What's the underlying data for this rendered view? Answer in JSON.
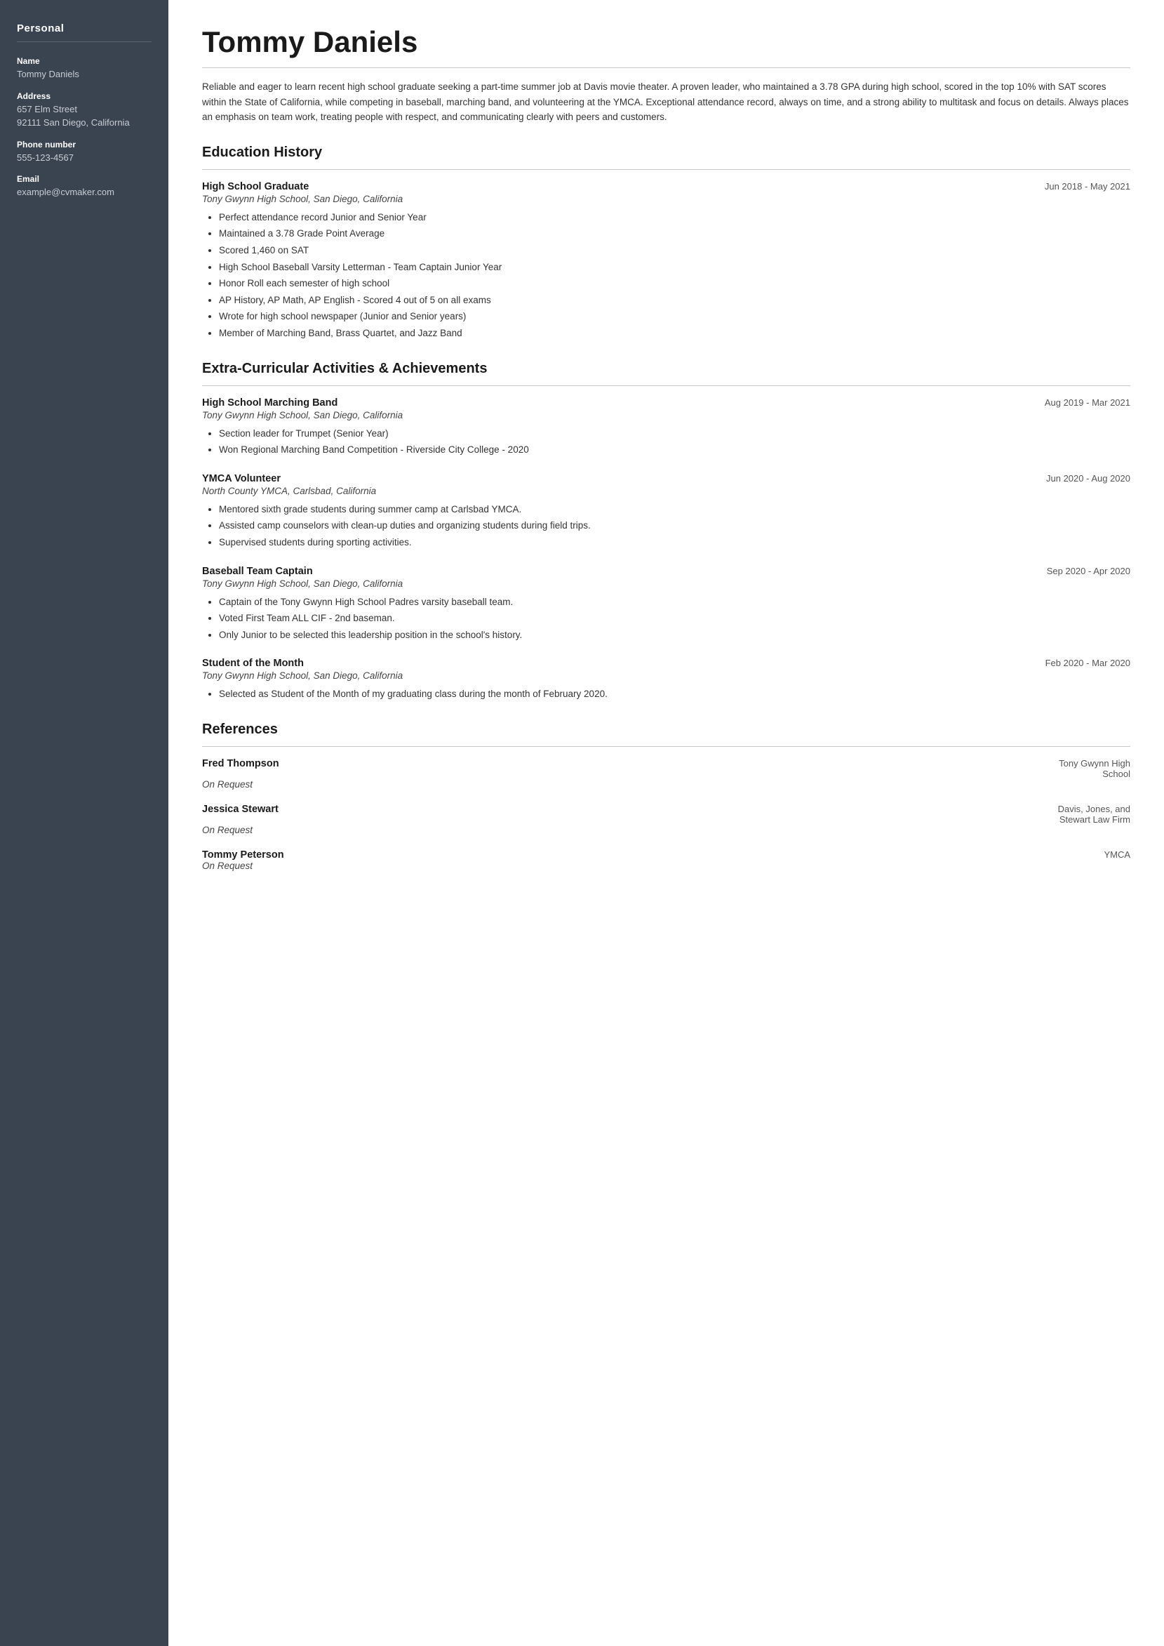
{
  "sidebar": {
    "section": "Personal",
    "fields": [
      {
        "label": "Name",
        "value": "Tommy Daniels"
      },
      {
        "label": "Address",
        "value": "657 Elm Street\n92111 San Diego, California"
      },
      {
        "label": "Phone number",
        "value": "555-123-4567"
      },
      {
        "label": "Email",
        "value": "example@cvmaker.com"
      }
    ]
  },
  "main": {
    "name": "Tommy Daniels",
    "summary": "Reliable and eager to learn recent high school graduate seeking a part-time summer job at Davis movie theater. A proven leader, who maintained a 3.78 GPA during high school, scored in the top 10% with SAT scores within the State of California, while competing in baseball, marching band, and volunteering at the YMCA. Exceptional attendance record, always on time, and a strong ability to multitask and focus on details. Always places an emphasis on team work, treating people with respect, and communicating clearly with peers and customers.",
    "sections": [
      {
        "title": "Education History",
        "entries": [
          {
            "title": "High School Graduate",
            "date": "Jun 2018 - May 2021",
            "subtitle": "Tony Gwynn High School, San Diego, California",
            "bullets": [
              "Perfect attendance record Junior and Senior Year",
              "Maintained a 3.78 Grade Point Average",
              "Scored 1,460 on SAT",
              "High School Baseball Varsity Letterman - Team Captain Junior Year",
              "Honor Roll each semester of high school",
              "AP History, AP Math, AP English - Scored 4 out of 5 on all exams",
              "Wrote for high school newspaper (Junior and Senior years)",
              "Member of Marching Band, Brass Quartet, and Jazz Band"
            ]
          }
        ]
      },
      {
        "title": "Extra-Curricular Activities & Achievements",
        "entries": [
          {
            "title": "High School Marching Band",
            "date": "Aug 2019 - Mar 2021",
            "subtitle": "Tony Gwynn High School, San Diego, California",
            "bullets": [
              "Section leader for Trumpet (Senior Year)",
              "Won Regional Marching Band Competition - Riverside City College - 2020"
            ]
          },
          {
            "title": "YMCA Volunteer",
            "date": "Jun 2020 - Aug 2020",
            "subtitle": "North County YMCA, Carlsbad, California",
            "bullets": [
              "Mentored sixth grade students during summer camp at Carlsbad YMCA.",
              "Assisted camp counselors with clean-up duties and organizing students during field trips.",
              "Supervised students during sporting activities."
            ]
          },
          {
            "title": "Baseball Team Captain",
            "date": "Sep 2020 - Apr 2020",
            "subtitle": "Tony Gwynn High School, San Diego, California",
            "bullets": [
              "Captain of the Tony Gwynn High School Padres varsity baseball team.",
              "Voted First Team ALL CIF - 2nd baseman.",
              "Only Junior to be selected this leadership position in the school's history."
            ]
          },
          {
            "title": "Student of the Month",
            "date": "Feb 2020 - Mar 2020",
            "subtitle": "Tony Gwynn High School, San Diego, California",
            "bullets": [
              "Selected as Student of the Month of my graduating class during the month of February 2020."
            ]
          }
        ]
      },
      {
        "title": "References",
        "refs": [
          {
            "name": "Fred Thompson",
            "subtitle": "On Request",
            "org": "Tony Gwynn High\nSchool"
          },
          {
            "name": "Jessica Stewart",
            "subtitle": "On Request",
            "org": "Davis, Jones, and\nStewart Law Firm"
          },
          {
            "name": "Tommy Peterson",
            "subtitle": "On Request",
            "org": "YMCA"
          }
        ]
      }
    ]
  }
}
